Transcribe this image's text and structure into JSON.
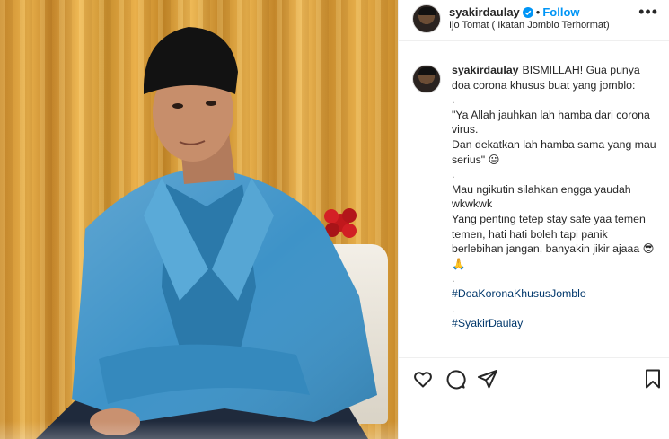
{
  "post": {
    "username": "syakirdaulay",
    "follow_label": "Follow",
    "separator": "•",
    "location": "Ijo Tomat ( Ikatan Jomblo Terhormat)",
    "more_label": "•••",
    "caption": {
      "username": "syakirdaulay",
      "line_1": "BISMILLAH! Gua punya doa corona khusus buat yang jomblo:",
      "dot_1": ".",
      "line_2": "\"Ya Allah jauhkan lah hamba dari corona virus.",
      "line_3": "Dan dekatkan lah hamba sama yang mau serius\" 😛",
      "dot_2": ".",
      "line_4": "Mau ngikutin silahkan engga yaudah wkwkwk",
      "line_5": "Yang penting tetep stay safe yaa temen temen, hati hati boleh tapi panik berlebihan jangan, banyakin jikir ajaaa 😎🙏",
      "dot_3": ".",
      "hashtag_1": "#DoaKoronaKhususJomblo",
      "dot_4": ".",
      "hashtag_2": "#SyakirDaulay"
    },
    "icons": {
      "verified": "verified-badge-icon",
      "like": "heart-icon",
      "comment": "comment-icon",
      "share": "paper-plane-icon",
      "save": "bookmark-icon"
    },
    "colors": {
      "link": "#0095f6",
      "hashtag": "#00376b",
      "text": "#262626",
      "border": "#efefef"
    }
  }
}
